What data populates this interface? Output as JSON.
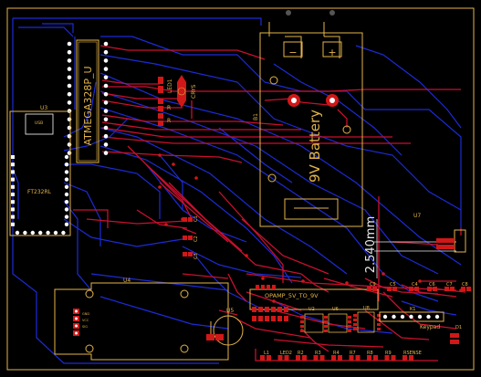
{
  "board": {
    "colors": {
      "background": "#000000",
      "top_copper": "#c8102e",
      "bottom_copper": "#1c2bd6",
      "silkscreen": "#e3b44a",
      "pad": "#d01818",
      "pin_white": "#ffffff"
    }
  },
  "labels": {
    "atmega": "ATMEGA328P_U",
    "led1": "LED1",
    "crystal": "CRYS",
    "r_near_mcu_1": "R",
    "r_near_mcu_2": "R",
    "u3": "U3",
    "usb": "USB",
    "ft232": "FT232RL",
    "b1": "B1",
    "battery": "9V Battery",
    "plus": "+",
    "minus": "−",
    "dimension": "2.540mm",
    "u7": "U7",
    "u4": "U4",
    "c1": "C1",
    "c2": "C2",
    "c3": "C3",
    "opamp": "OPAMP_5V_TO_9V",
    "u5": "U5",
    "u2": "U2",
    "u6": "U6",
    "u8": "U8",
    "c5": "C5",
    "c4": "C4",
    "c6": "C6",
    "c7": "C7",
    "c8": "C8",
    "c9": "C9",
    "k1": "K1",
    "keypad": "Keypad",
    "d1": "D1",
    "l1": "L1",
    "led2": "LED2",
    "r2": "R2",
    "r3": "R3",
    "r4": "R4",
    "r7": "R7",
    "r8": "R8",
    "r9": "R9",
    "rsense": "RSENSE"
  }
}
